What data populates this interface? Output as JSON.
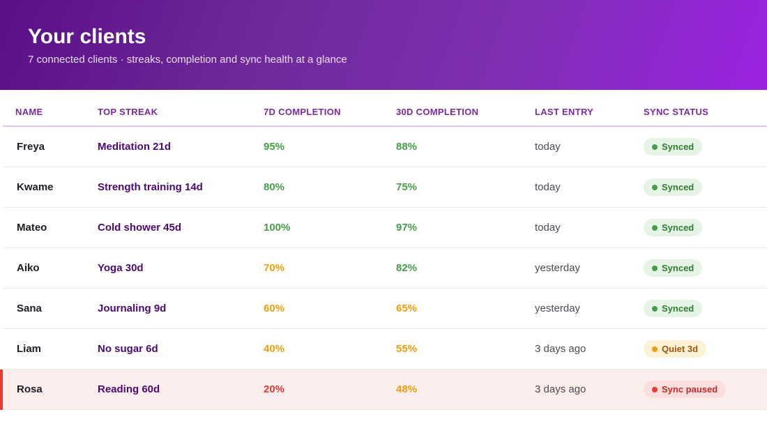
{
  "header": {
    "title": "Your clients",
    "subtitle": "7 connected clients · streaks, completion and sync health at a glance"
  },
  "columns": {
    "name": "NAME",
    "top_streak": "TOP STREAK",
    "completion_7d": "7D COMPLETION",
    "completion_30d": "30D COMPLETION",
    "last_entry": "LAST ENTRY",
    "sync_status": "SYNC STATUS"
  },
  "colors": {
    "good": "#43a047",
    "warn": "#f29d0a",
    "bad": "#e53935",
    "synced_bg": "#e6f4e6",
    "synced_fg": "#2e7d32",
    "quiet_bg": "#fdf1d6",
    "quiet_fg": "#a0560a",
    "paused_bg": "#fcdede",
    "paused_fg": "#c62828"
  },
  "rows": [
    {
      "name": "Freya",
      "streak": "Meditation 21d",
      "c7": "95%",
      "c7_level": "good",
      "c30": "88%",
      "c30_level": "good",
      "last": "today",
      "sync": "Synced",
      "sync_type": "synced"
    },
    {
      "name": "Kwame",
      "streak": "Strength training 14d",
      "c7": "80%",
      "c7_level": "good",
      "c30": "75%",
      "c30_level": "good",
      "last": "today",
      "sync": "Synced",
      "sync_type": "synced"
    },
    {
      "name": "Mateo",
      "streak": "Cold shower 45d",
      "c7": "100%",
      "c7_level": "good",
      "c30": "97%",
      "c30_level": "good",
      "last": "today",
      "sync": "Synced",
      "sync_type": "synced"
    },
    {
      "name": "Aiko",
      "streak": "Yoga 30d",
      "c7": "70%",
      "c7_level": "warn",
      "c30": "82%",
      "c30_level": "good",
      "last": "yesterday",
      "sync": "Synced",
      "sync_type": "synced"
    },
    {
      "name": "Sana",
      "streak": "Journaling 9d",
      "c7": "60%",
      "c7_level": "warn",
      "c30": "65%",
      "c30_level": "warn",
      "last": "yesterday",
      "sync": "Synced",
      "sync_type": "synced"
    },
    {
      "name": "Liam",
      "streak": "No sugar 6d",
      "c7": "40%",
      "c7_level": "warn",
      "c30": "55%",
      "c30_level": "warn",
      "last": "3 days ago",
      "sync": "Quiet 3d",
      "sync_type": "quiet"
    },
    {
      "name": "Rosa",
      "streak": "Reading 60d",
      "c7": "20%",
      "c7_level": "bad",
      "c30": "48%",
      "c30_level": "warn",
      "last": "3 days ago",
      "sync": "Sync paused",
      "sync_type": "paused",
      "alert": true
    }
  ]
}
